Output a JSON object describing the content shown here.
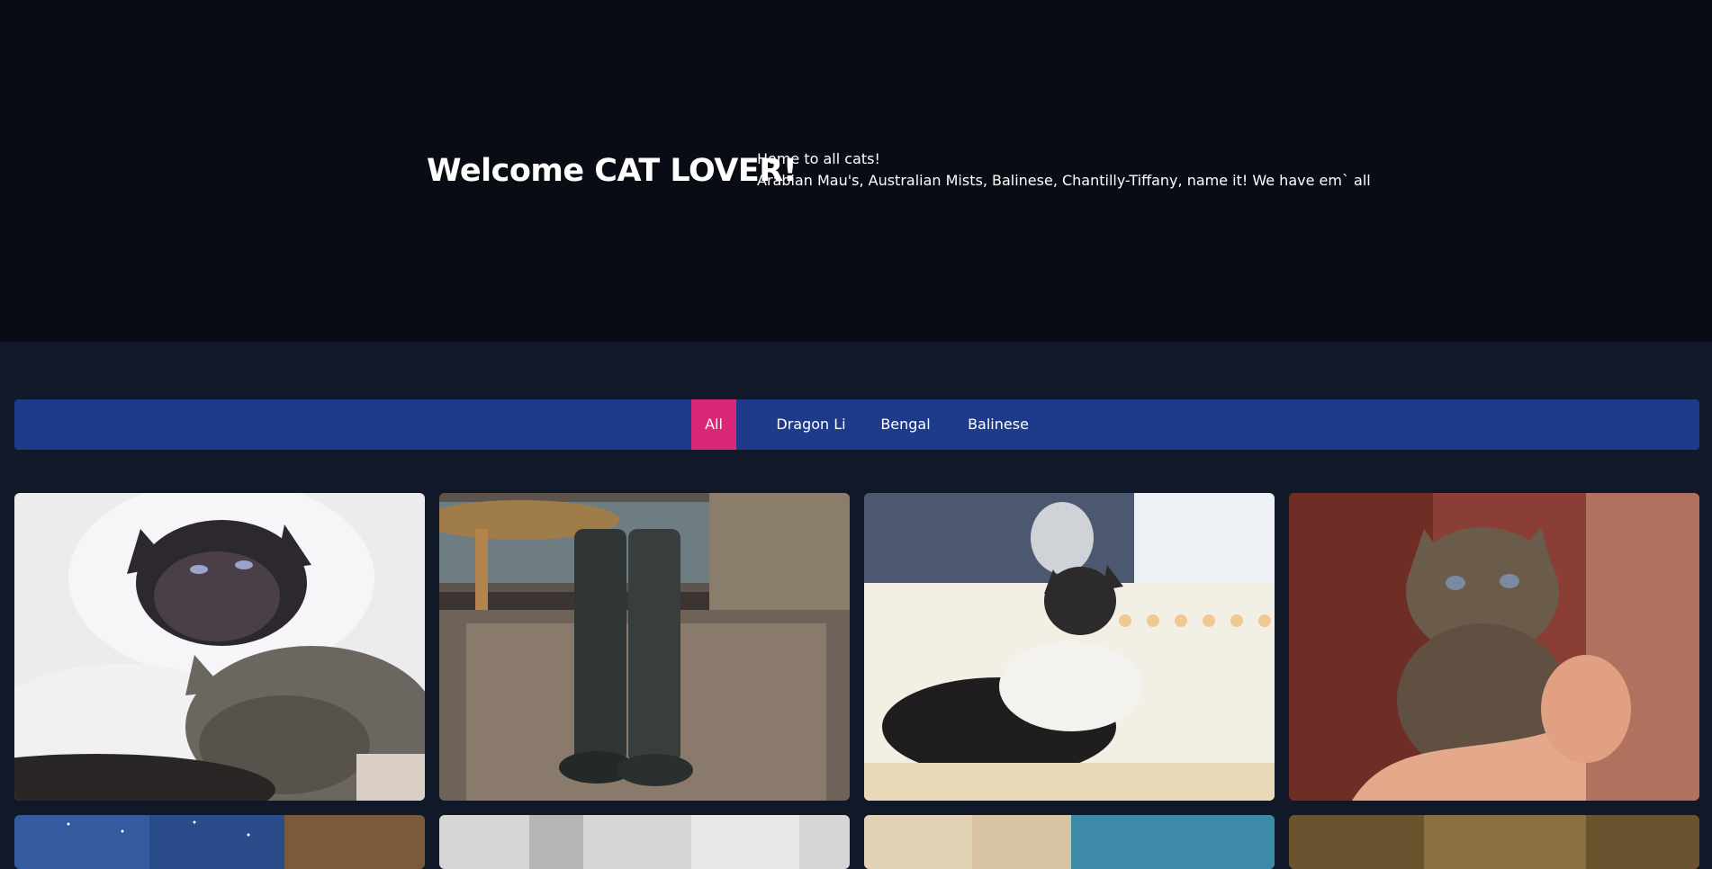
{
  "hero": {
    "title": "Welcome CAT LOVER!",
    "line1": "Home to all cats!",
    "line2": "Arabian Mau's, Australian Mists, Balinese, Chantilly-Tiffany, name it! We have em` all"
  },
  "filters": {
    "items": [
      {
        "label": "All",
        "active": true
      },
      {
        "label": "Dragon Li",
        "active": false
      },
      {
        "label": "Bengal",
        "active": false
      },
      {
        "label": "Balinese",
        "active": false
      }
    ]
  },
  "colors": {
    "hero_bg": "#090c15",
    "page_bg": "#111827",
    "filter_bar": "#1e3a8a",
    "filter_active": "#db2777",
    "loader_dot": "#f0a850"
  },
  "gallery": {
    "images": [
      {
        "icon": "cat-photo-himalayan-and-tabby"
      },
      {
        "icon": "cat-photo-rubber-boots"
      },
      {
        "icon": "cat-photo-cat-on-bed"
      },
      {
        "icon": "cat-photo-kitten-in-hands"
      },
      {
        "icon": "cat-photo-starry-sky"
      },
      {
        "icon": "cat-photo-gray"
      },
      {
        "icon": "cat-photo-beige"
      },
      {
        "icon": "cat-photo-brown"
      }
    ]
  },
  "loader": {
    "icon": "loading-dots-icon",
    "dot_count": 6
  }
}
